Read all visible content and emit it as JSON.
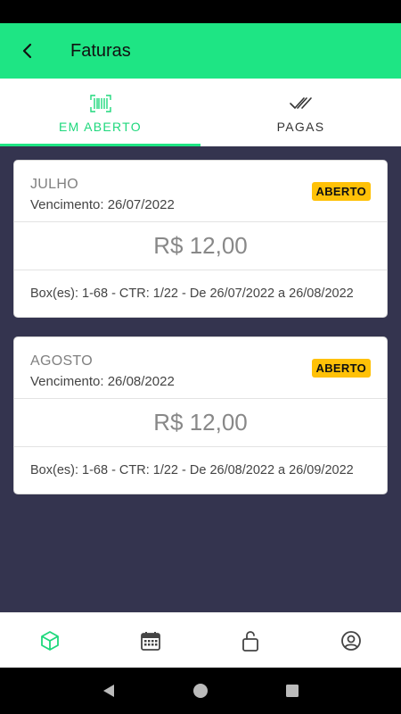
{
  "app_bar": {
    "title": "Faturas"
  },
  "tabs": [
    {
      "label": "EM ABERTO",
      "icon": "barcode-icon",
      "active": true
    },
    {
      "label": "PAGAS",
      "icon": "double-check-icon",
      "active": false
    }
  ],
  "invoices": [
    {
      "month": "JULHO",
      "due": "Vencimento: 26/07/2022",
      "status": "ABERTO",
      "amount": "R$ 12,00",
      "info": "Box(es): 1-68 - CTR: 1/22 - De 26/07/2022 a 26/08/2022"
    },
    {
      "month": "AGOSTO",
      "due": "Vencimento: 26/08/2022",
      "status": "ABERTO",
      "amount": "R$ 12,00",
      "info": "Box(es): 1-68 - CTR: 1/22 - De 26/08/2022 a 26/09/2022"
    }
  ],
  "bottom_nav": [
    {
      "icon": "box-icon",
      "active": true
    },
    {
      "icon": "calendar-icon",
      "active": false
    },
    {
      "icon": "unlock-icon",
      "active": false
    },
    {
      "icon": "account-icon",
      "active": false
    }
  ],
  "colors": {
    "primary": "#1ee584",
    "accent_text": "#1ed87c",
    "background": "#34344f",
    "badge": "#ffc107"
  }
}
